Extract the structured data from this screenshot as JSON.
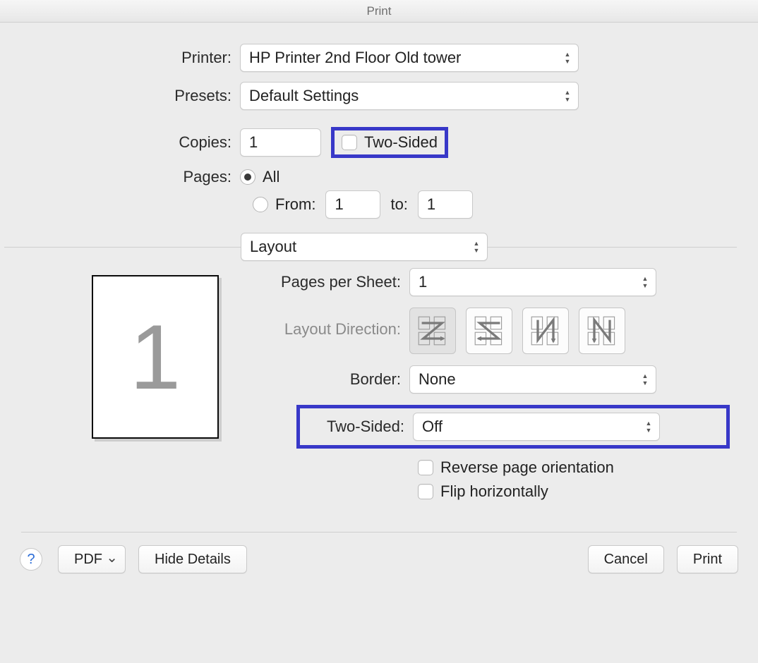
{
  "title": "Print",
  "form": {
    "printer_label": "Printer:",
    "printer_value": "HP Printer 2nd Floor Old tower",
    "presets_label": "Presets:",
    "presets_value": "Default Settings",
    "copies_label": "Copies:",
    "copies_value": "1",
    "two_sided_checkbox_label": "Two-Sided",
    "pages_label": "Pages:",
    "pages_all_label": "All",
    "pages_from_label": "From:",
    "pages_from_value": "1",
    "pages_to_label": "to:",
    "pages_to_value": "1",
    "section_select_value": "Layout"
  },
  "layout": {
    "preview_number": "1",
    "pages_per_sheet_label": "Pages per Sheet:",
    "pages_per_sheet_value": "1",
    "layout_direction_label": "Layout Direction:",
    "border_label": "Border:",
    "border_value": "None",
    "two_sided_label": "Two-Sided:",
    "two_sided_value": "Off",
    "reverse_label": "Reverse page orientation",
    "flip_label": "Flip horizontally"
  },
  "footer": {
    "pdf_label": "PDF",
    "hide_details_label": "Hide Details",
    "cancel_label": "Cancel",
    "print_label": "Print"
  }
}
